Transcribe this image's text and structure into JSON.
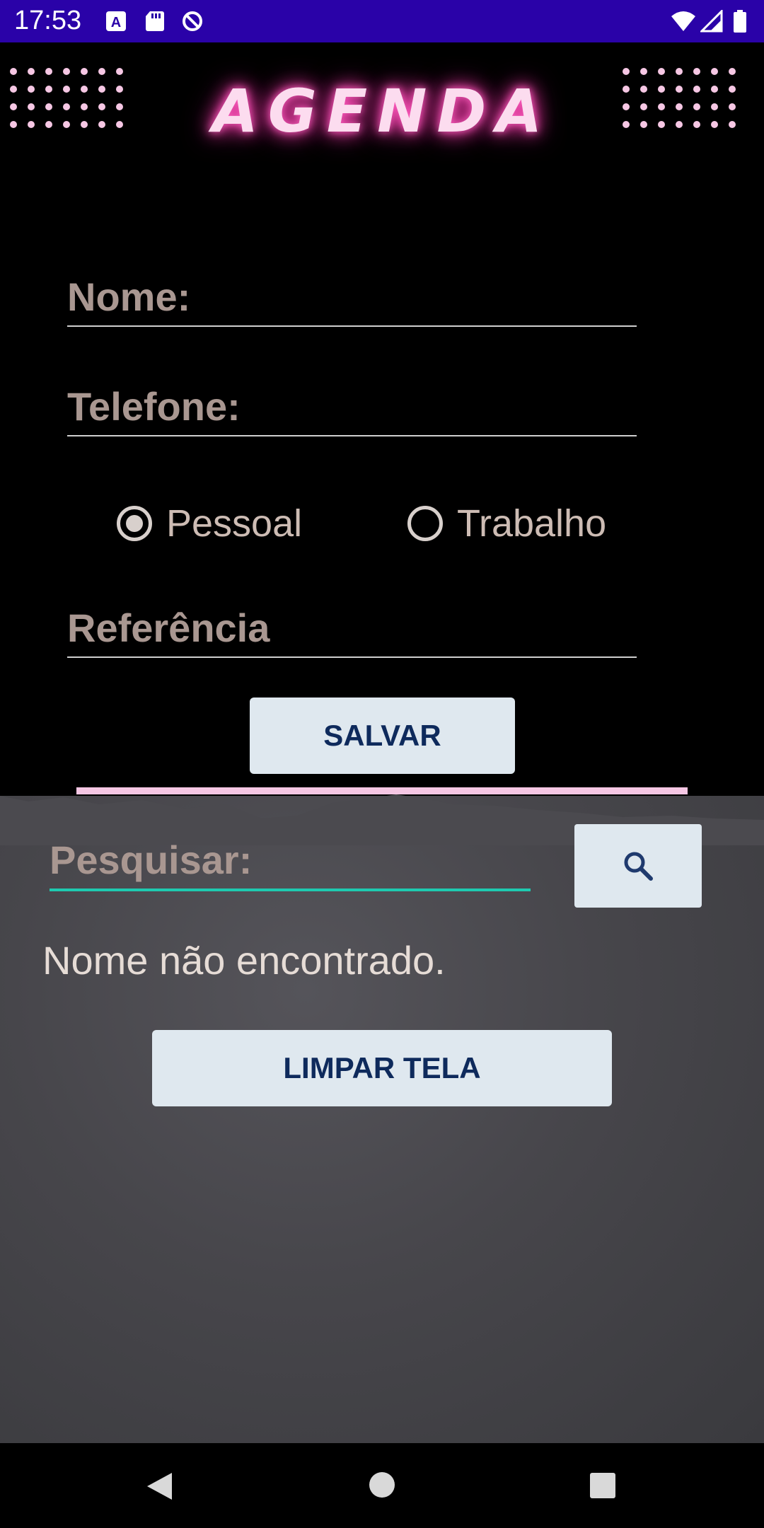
{
  "status_bar": {
    "time": "17:53",
    "left_icons": [
      "font-download-icon",
      "sd-card-icon",
      "data-saver-icon"
    ],
    "right_icons": [
      "wifi-icon",
      "cellular-signal-icon",
      "battery-icon"
    ],
    "background": "#2a02a8"
  },
  "header": {
    "title": "AGENDA",
    "title_color": "#fcdcef",
    "glow_color": "#ff3cae"
  },
  "form": {
    "name_placeholder": "Nome:",
    "phone_placeholder": "Telefone:",
    "radio_options": [
      {
        "label": "Pessoal",
        "checked": true
      },
      {
        "label": "Trabalho",
        "checked": false
      }
    ],
    "reference_placeholder": "Referência",
    "save_label": "SALVAR"
  },
  "search": {
    "placeholder": "Pesquisar:",
    "button_icon": "search-icon",
    "underline_color": "#1ecab0"
  },
  "result_message": "Nome não encontrado.",
  "clear_label": "LIMPAR TELA",
  "colors": {
    "button_bg": "#dfe8ef",
    "button_text": "#0e2a5c",
    "accent_pink": "#f6c7e4"
  },
  "nav_bar": {
    "icons": [
      "back-icon",
      "home-icon",
      "recents-icon"
    ]
  }
}
